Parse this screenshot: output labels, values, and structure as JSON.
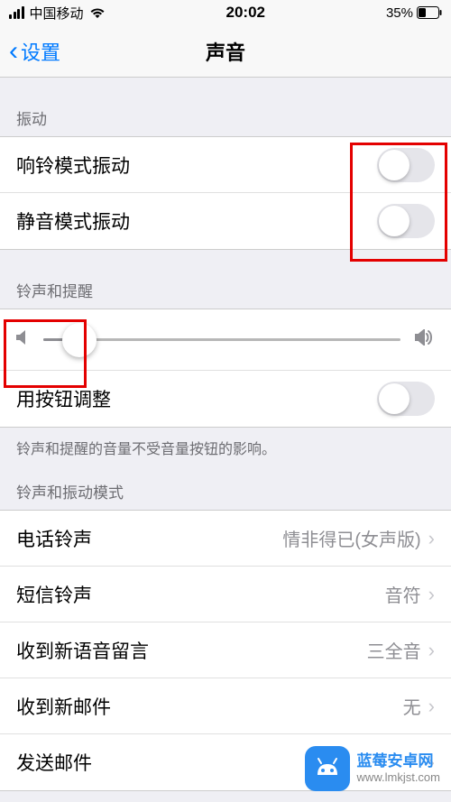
{
  "status": {
    "carrier": "中国移动",
    "time": "20:02",
    "battery": "35%"
  },
  "nav": {
    "back": "设置",
    "title": "声音"
  },
  "sections": {
    "vibration": {
      "header": "振动",
      "ring_label": "响铃模式振动",
      "silent_label": "静音模式振动"
    },
    "ringer": {
      "header": "铃声和提醒",
      "button_adjust_label": "用按钮调整",
      "footer": "铃声和提醒的音量不受音量按钮的影响。",
      "slider_value": 10
    },
    "patterns": {
      "header": "铃声和振动模式",
      "items": [
        {
          "label": "电话铃声",
          "value": "情非得已(女声版)"
        },
        {
          "label": "短信铃声",
          "value": "音符"
        },
        {
          "label": "收到新语音留言",
          "value": "三全音"
        },
        {
          "label": "收到新邮件",
          "value": "无"
        },
        {
          "label": "发送邮件",
          "value": ""
        }
      ]
    }
  },
  "watermark": {
    "title": "蓝莓安卓网",
    "url": "www.lmkjst.com"
  }
}
